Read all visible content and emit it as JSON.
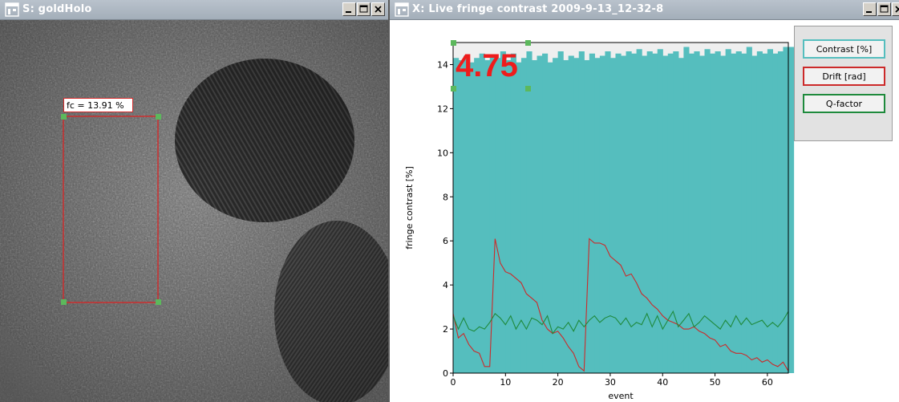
{
  "colors": {
    "titlebar": "#a9b3bd",
    "contrast_fill": "#55bebe",
    "drift_line": "#cc2a2a",
    "qfactor_line": "#1e8a3c",
    "readout": "#ee1c1c",
    "roi_handle": "#5cb85c"
  },
  "left_window": {
    "title": "S: goldHolo",
    "icon": "window-app-icon",
    "roi_label": "fc = 13.91 %"
  },
  "right_window": {
    "title": "X: Live fringe contrast  2009-9-13_12-32-8",
    "icon": "window-app-icon",
    "readout": "4.75",
    "legend": [
      {
        "label": "Contrast [%]",
        "color": "#55bebe"
      },
      {
        "label": "Drift [rad]",
        "color": "#cc2a2a"
      },
      {
        "label": "Q-factor",
        "color": "#1e8a3c"
      }
    ]
  },
  "window_buttons": [
    "minimize-icon",
    "maximize-icon",
    "close-icon"
  ],
  "chart_data": {
    "type": "line",
    "xlabel": "event",
    "ylabel": "fringe contrast [%]",
    "xlim": [
      0,
      64
    ],
    "ylim": [
      0,
      15
    ],
    "xticks": [
      0,
      10,
      20,
      30,
      40,
      50,
      60
    ],
    "yticks": [
      0,
      2,
      4,
      6,
      8,
      10,
      12,
      14
    ],
    "grid": false,
    "legend_position": "right",
    "x": [
      0,
      1,
      2,
      3,
      4,
      5,
      6,
      7,
      8,
      9,
      10,
      11,
      12,
      13,
      14,
      15,
      16,
      17,
      18,
      19,
      20,
      21,
      22,
      23,
      24,
      25,
      26,
      27,
      28,
      29,
      30,
      31,
      32,
      33,
      34,
      35,
      36,
      37,
      38,
      39,
      40,
      41,
      42,
      43,
      44,
      45,
      46,
      47,
      48,
      49,
      50,
      51,
      52,
      53,
      54,
      55,
      56,
      57,
      58,
      59,
      60,
      61,
      62,
      63,
      64
    ],
    "series": [
      {
        "name": "Contrast [%]",
        "type": "bar",
        "values": [
          14.3,
          14.2,
          14.4,
          14.1,
          14.3,
          14.5,
          14.2,
          14.4,
          14.3,
          14.6,
          14.2,
          14.5,
          14.1,
          14.3,
          14.6,
          14.2,
          14.4,
          14.5,
          14.1,
          14.3,
          14.6,
          14.2,
          14.4,
          14.3,
          14.6,
          14.2,
          14.5,
          14.3,
          14.4,
          14.6,
          14.3,
          14.5,
          14.4,
          14.6,
          14.5,
          14.7,
          14.4,
          14.6,
          14.5,
          14.7,
          14.4,
          14.5,
          14.6,
          14.3,
          14.8,
          14.5,
          14.6,
          14.4,
          14.7,
          14.5,
          14.6,
          14.4,
          14.7,
          14.5,
          14.6,
          14.5,
          14.8,
          14.4,
          14.6,
          14.5,
          14.7,
          14.5,
          14.6,
          14.8,
          14.8
        ]
      },
      {
        "name": "Drift [rad]",
        "values": [
          2.7,
          1.6,
          1.8,
          1.3,
          1.0,
          0.9,
          0.3,
          0.3,
          6.1,
          5.0,
          4.6,
          4.5,
          4.3,
          4.1,
          3.6,
          3.4,
          3.2,
          2.4,
          2.0,
          1.8,
          1.9,
          1.6,
          1.2,
          0.9,
          0.3,
          0.1,
          6.1,
          5.9,
          5.9,
          5.8,
          5.3,
          5.1,
          4.9,
          4.4,
          4.5,
          4.1,
          3.6,
          3.4,
          3.1,
          2.9,
          2.6,
          2.4,
          2.3,
          2.2,
          2.0,
          2.0,
          2.1,
          1.9,
          1.8,
          1.6,
          1.5,
          1.2,
          1.3,
          1.0,
          0.9,
          0.9,
          0.8,
          0.6,
          0.7,
          0.5,
          0.6,
          0.4,
          0.3,
          0.5,
          0.1
        ]
      },
      {
        "name": "Q-factor",
        "values": [
          2.6,
          2.0,
          2.5,
          2.0,
          1.9,
          2.1,
          2.0,
          2.3,
          2.7,
          2.5,
          2.2,
          2.6,
          2.0,
          2.4,
          2.0,
          2.5,
          2.4,
          2.2,
          2.6,
          1.8,
          2.1,
          2.0,
          2.3,
          1.9,
          2.4,
          2.1,
          2.4,
          2.6,
          2.3,
          2.5,
          2.6,
          2.5,
          2.2,
          2.5,
          2.1,
          2.3,
          2.2,
          2.7,
          2.1,
          2.6,
          2.0,
          2.4,
          2.8,
          2.1,
          2.4,
          2.7,
          2.1,
          2.3,
          2.6,
          2.4,
          2.2,
          2.0,
          2.4,
          2.1,
          2.6,
          2.2,
          2.5,
          2.2,
          2.3,
          2.4,
          2.1,
          2.3,
          2.1,
          2.4,
          2.8
        ]
      }
    ]
  }
}
